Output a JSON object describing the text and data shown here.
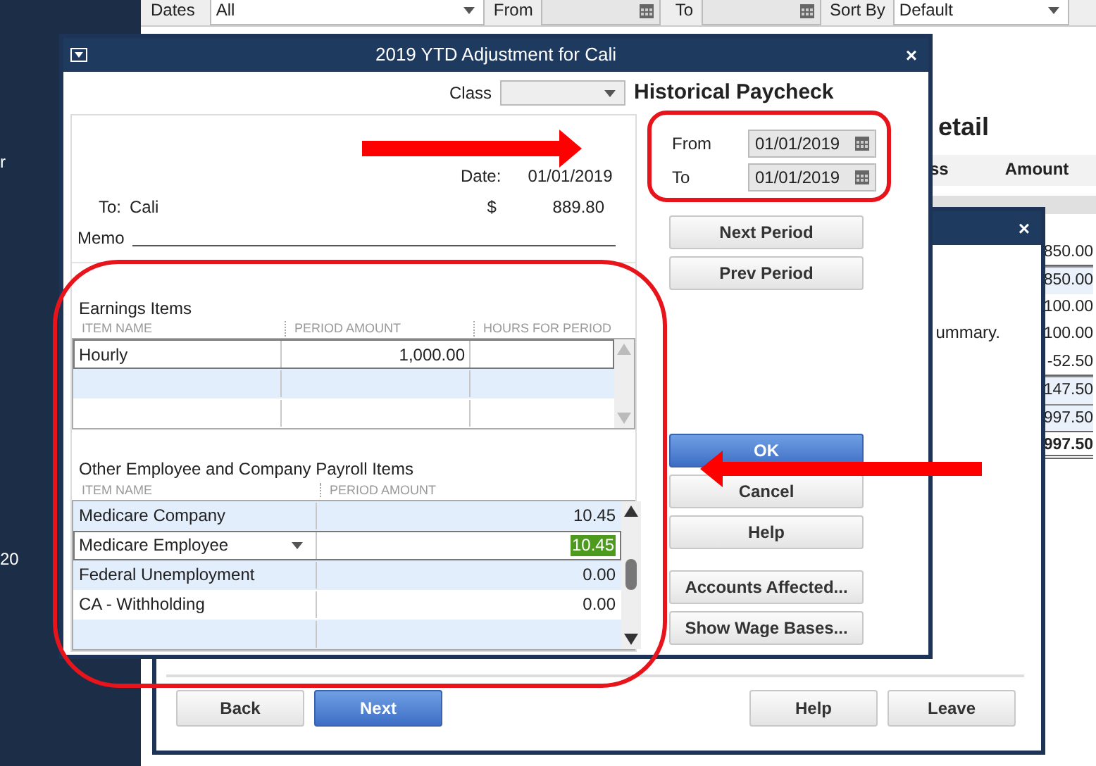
{
  "app": {
    "sidebar_texts": [
      "r",
      "20"
    ],
    "filters": {
      "dates_label": "Dates",
      "dates_value": "All",
      "from_label": "From",
      "to_label": "To",
      "sort_label": "Sort By",
      "sort_value": "Default"
    },
    "report": {
      "title": "etail",
      "columns": [
        "ss",
        "Amount"
      ],
      "amounts": [
        {
          "value": "850.00",
          "kind": "underlined"
        },
        {
          "value": "850.00",
          "kind": "shaded"
        },
        {
          "value": "100.00",
          "kind": "plain"
        },
        {
          "value": "100.00",
          "kind": "plain"
        },
        {
          "value": "-52.50",
          "kind": "underlined"
        },
        {
          "value": "147.50",
          "kind": "shaded"
        },
        {
          "value": "997.50",
          "kind": "shaded"
        },
        {
          "value": "997.50",
          "kind": "total"
        }
      ]
    }
  },
  "wizard": {
    "close_glyph": "×",
    "text": "ummary.",
    "left_buttons": [
      {
        "label": "Back",
        "kind": "default"
      },
      {
        "label": "Next",
        "kind": "primary"
      }
    ],
    "right_buttons": [
      {
        "label": "Help",
        "kind": "default"
      },
      {
        "label": "Leave",
        "kind": "default"
      }
    ]
  },
  "dialog": {
    "title": "2019 YTD Adjustment for Cali",
    "close_glyph": "×",
    "class_label": "Class",
    "heading": "Historical Paycheck",
    "check": {
      "date_label": "Date:",
      "date": "01/01/2019",
      "to_label": "To:",
      "payee": "Cali",
      "currency": "$",
      "amount": "889.80",
      "memo_label": "Memo"
    },
    "earnings": {
      "title": "Earnings Items",
      "columns": [
        "ITEM NAME",
        "PERIOD AMOUNT",
        "HOURS FOR PERIOD"
      ],
      "rows": [
        {
          "item": "Hourly",
          "amount": "1,000.00",
          "selected": true
        }
      ]
    },
    "other_items": {
      "title": "Other Employee and Company Payroll Items",
      "columns": [
        "ITEM NAME",
        "PERIOD AMOUNT"
      ],
      "rows": [
        {
          "item": "Medicare Company",
          "amount": "10.45",
          "selected": false
        },
        {
          "item": "Medicare Employee",
          "amount": "10.45",
          "selected": true
        },
        {
          "item": "Federal Unemployment",
          "amount": "0.00",
          "selected": false
        },
        {
          "item": "CA - Withholding",
          "amount": "0.00",
          "selected": false
        }
      ]
    },
    "period": {
      "from_label": "From",
      "from": "01/01/2019",
      "to_label": "To",
      "to": "01/01/2019"
    },
    "period_buttons": [
      {
        "label": "Next Period",
        "kind": "default"
      },
      {
        "label": "Prev Period",
        "kind": "default"
      }
    ],
    "action_buttons": [
      {
        "label": "OK",
        "kind": "primary"
      },
      {
        "label": "Cancel",
        "kind": "default"
      },
      {
        "label": "Help",
        "kind": "default"
      }
    ],
    "extra_buttons": [
      {
        "label": "Accounts Affected...",
        "kind": "default"
      },
      {
        "label": "Show Wage Bases...",
        "kind": "default"
      }
    ]
  }
}
